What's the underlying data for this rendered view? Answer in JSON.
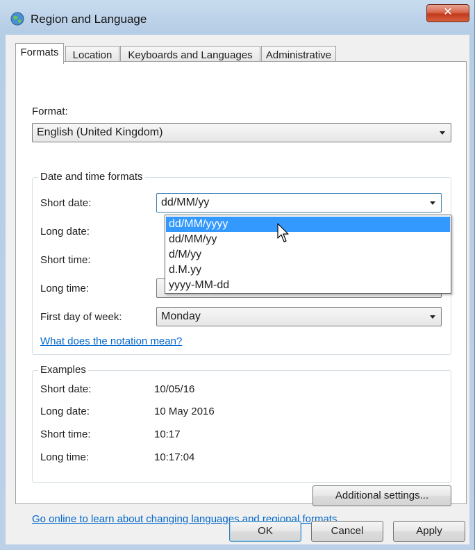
{
  "window": {
    "title": "Region and Language",
    "close_glyph": "✕"
  },
  "tabs": [
    {
      "label": "Formats",
      "active": true
    },
    {
      "label": "Location",
      "active": false
    },
    {
      "label": "Keyboards and Languages",
      "active": false
    },
    {
      "label": "Administrative",
      "active": false
    }
  ],
  "format": {
    "label": "Format:",
    "value": "English (United Kingdom)"
  },
  "date_time_formats": {
    "title": "Date and time formats",
    "short_date": {
      "label": "Short date:",
      "value": "dd/MM/yy"
    },
    "long_date": {
      "label": "Long date:"
    },
    "short_time": {
      "label": "Short time:"
    },
    "long_time": {
      "label": "Long time:"
    },
    "first_day": {
      "label": "First day of week:",
      "value": "Monday"
    },
    "dropdown_options": [
      "dd/MM/yyyy",
      "dd/MM/yy",
      "d/M/yy",
      "d.M.yy",
      "yyyy-MM-dd"
    ],
    "dropdown_selected_index": 0,
    "notation_link": "What does the notation mean?"
  },
  "examples": {
    "title": "Examples",
    "rows": [
      {
        "label": "Short date:",
        "value": "10/05/16"
      },
      {
        "label": "Long date:",
        "value": "10 May 2016"
      },
      {
        "label": "Short time:",
        "value": "10:17"
      },
      {
        "label": "Long time:",
        "value": "10:17:04"
      }
    ]
  },
  "additional_settings_label": "Additional settings...",
  "online_link": "Go online to learn about changing languages and regional formats",
  "buttons": {
    "ok": "OK",
    "cancel": "Cancel",
    "apply": "Apply"
  },
  "colors": {
    "accent": "#3399ff",
    "link": "#0066cc",
    "close": "#c23a1d"
  }
}
